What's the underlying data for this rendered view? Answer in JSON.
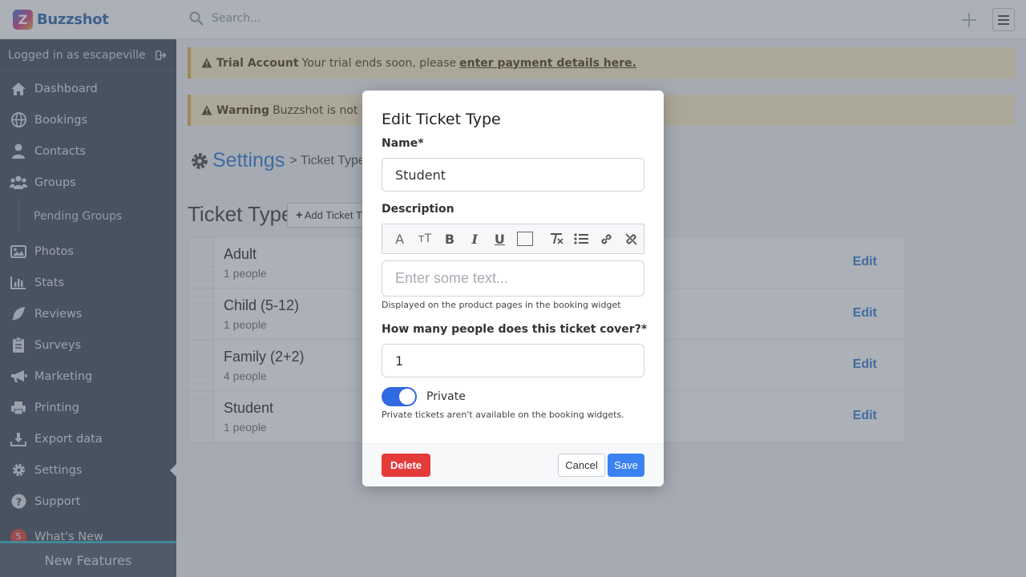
{
  "topbar": {
    "brand_name": "Buzzshot",
    "logo_letter": "Z",
    "search_placeholder": "Search..."
  },
  "sidebar": {
    "logged_in_text": "Logged in as escapeville",
    "items": [
      {
        "label": "Dashboard",
        "icon": "home-icon"
      },
      {
        "label": "Bookings",
        "icon": "globe-icon"
      },
      {
        "label": "Contacts",
        "icon": "user-icon"
      },
      {
        "label": "Groups",
        "icon": "users-icon"
      },
      {
        "label": "Photos",
        "icon": "image-icon"
      },
      {
        "label": "Stats",
        "icon": "bar-chart-icon"
      },
      {
        "label": "Reviews",
        "icon": "feather-icon"
      },
      {
        "label": "Surveys",
        "icon": "clipboard-icon"
      },
      {
        "label": "Marketing",
        "icon": "megaphone-icon"
      },
      {
        "label": "Printing",
        "icon": "printer-icon"
      },
      {
        "label": "Export data",
        "icon": "download-icon"
      },
      {
        "label": "Settings",
        "icon": "gear-icon"
      },
      {
        "label": "Support",
        "icon": "question-icon"
      }
    ],
    "sub_item": "Pending Groups",
    "whats_new": {
      "label": "What's New",
      "badge": "5"
    },
    "new_features": "New Features"
  },
  "alerts": {
    "trial": {
      "title": "Trial Account",
      "text": "Your trial ends soon, please",
      "link": "enter payment details here."
    },
    "warning": {
      "title": "Warning",
      "text": "Buzzshot is not yet a"
    }
  },
  "page": {
    "settings_title": "Settings",
    "crumb": "> Ticket Types",
    "ticket_types_title": "Ticket Types",
    "add_button": "Add Ticket Ty"
  },
  "ticket_types": [
    {
      "name": "Adult",
      "count": "1 people",
      "edit": "Edit"
    },
    {
      "name": "Child (5-12)",
      "count": "1 people",
      "edit": "Edit"
    },
    {
      "name": "Family (2+2)",
      "count": "4 people",
      "edit": "Edit"
    },
    {
      "name": "Student",
      "count": "1 people",
      "edit": "Edit"
    }
  ],
  "modal": {
    "title": "Edit Ticket Type",
    "name_label": "Name*",
    "name_value": "Student",
    "description_label": "Description",
    "description_placeholder": "Enter some text...",
    "description_help": "Displayed on the product pages in the booking widget",
    "people_label": "How many people does this ticket cover?*",
    "people_value": "1",
    "private_label": "Private",
    "private_on": true,
    "private_help": "Private tickets aren't available on the booking widgets.",
    "toolbar": {
      "font": "A",
      "size": "тT",
      "bold": "B",
      "italic": "I",
      "underline": "U"
    },
    "delete_button": "Delete",
    "cancel_button": "Cancel",
    "save_button": "Save"
  },
  "colors": {
    "accent": "#3b82d6",
    "toggle_on": "#2f6ae0",
    "danger": "#e53a3a",
    "sidebar_bg": "#4a5461"
  }
}
